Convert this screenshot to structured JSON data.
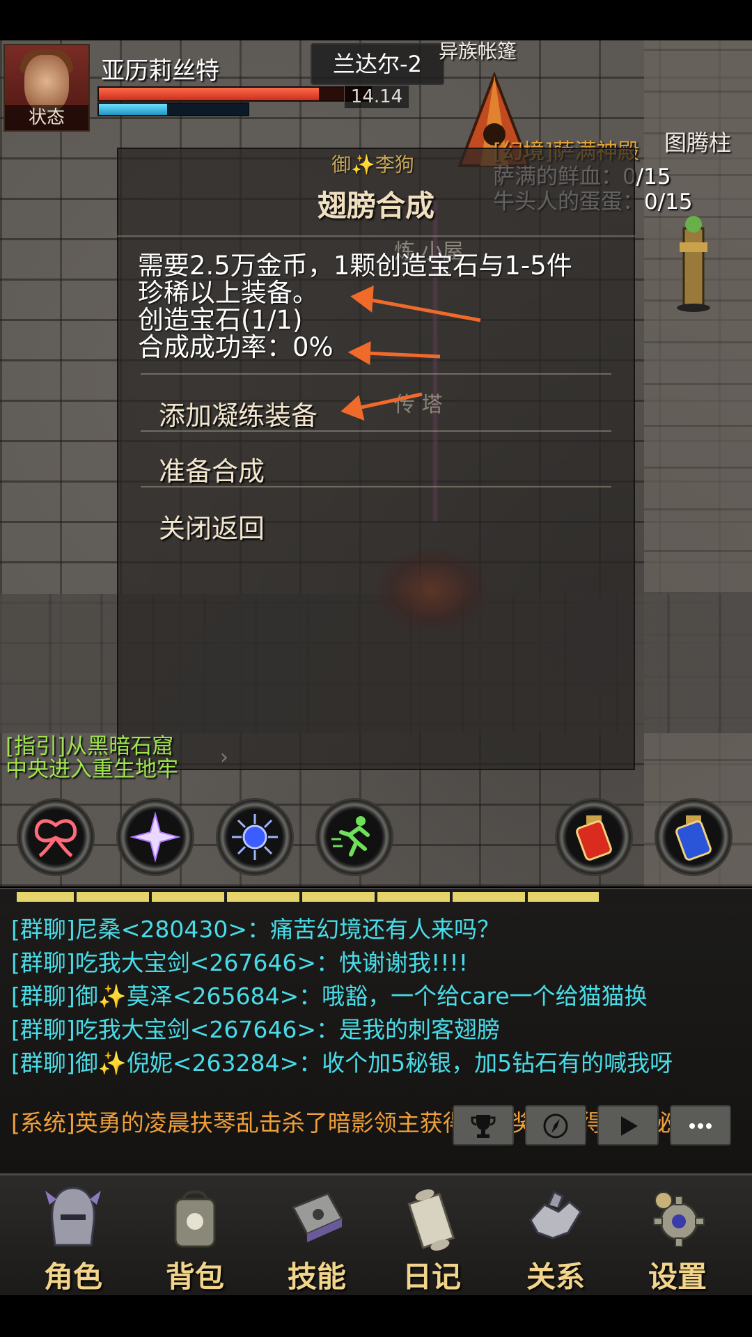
{
  "hud": {
    "player_name": "亚历莉丝特",
    "status_label": "状态",
    "map_name": "兰达尔-2",
    "coord_text": "14.14",
    "hp_fraction": 0.81,
    "mp_fraction": 0.46
  },
  "world_labels": {
    "tent": "异族帐篷",
    "totem": "图腾柱",
    "npc": "御✨李狗",
    "bg1": "炼    小屋",
    "bg2": "传    塔"
  },
  "quest": {
    "title": "[幻境]萨满神殿",
    "items": [
      "萨满的鲜血：0/15",
      "牛头人的蛋蛋：0/15"
    ]
  },
  "dialog": {
    "title": "翅膀合成",
    "desc_lines": [
      "需要2.5万金币，1颗创造宝石与1-5件",
      "珍稀以上装备。",
      "创造宝石(1/1)",
      "合成成功率：0%"
    ],
    "menu": [
      "添加凝练装备",
      "准备合成",
      "关闭返回"
    ]
  },
  "guide": {
    "line1": "[指引]从黑暗石窟",
    "line2": "中央进入重生地牢"
  },
  "skills": [
    {
      "icon": "wings-skill-icon",
      "color": "#ff6a7a"
    },
    {
      "icon": "star-strike-skill-icon",
      "color": "#e9b8ff"
    },
    {
      "icon": "frost-sun-skill-icon",
      "color": "#7aa0ff"
    },
    {
      "icon": "sprint-skill-icon",
      "color": "#6ee05a"
    },
    {
      "icon": "red-potion-icon",
      "color": "#d92b1e"
    },
    {
      "icon": "blue-potion-icon",
      "color": "#2a55d9"
    }
  ],
  "exp": {
    "fraction": 0.81
  },
  "chat": [
    "[群聊]尼桑<280430>：痛苦幻境还有人来吗？",
    "[群聊]吃我大宝剑<267646>：快谢谢我!!!!",
    "[群聊]御✨莫泽<265684>：哦豁，一个给care一个给猫猫换",
    "[群聊]吃我大宝剑<267646>：是我的刺客翅膀",
    "[群聊]御✨倪妮<263284>：收个加5秘银，加5钻石有的喊我呀",
    "[系统]英勇的凌晨扶琴乱击杀了暗影领主获得了大奖，获得了神秘宝石!"
  ],
  "chat_buttons": [
    "trophy-icon",
    "compass-icon",
    "play-icon",
    "chat-bubble-icon"
  ],
  "nav": [
    "角色",
    "背包",
    "技能",
    "日记",
    "关系",
    "设置"
  ],
  "colors": {
    "chat_group": "#49dce8",
    "chat_system": "#f0a03a",
    "guide": "#9fe34e",
    "nav_label": "#f2d58a",
    "arrow": "#f06a2a"
  }
}
